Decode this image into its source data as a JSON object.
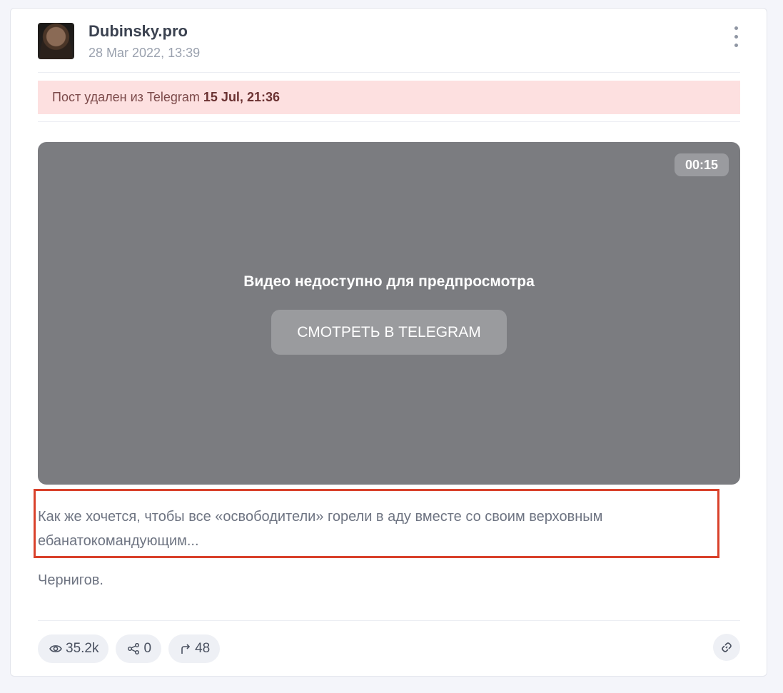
{
  "post": {
    "channel_name": "Dubinsky.pro",
    "date": "28 Mar 2022, 13:39",
    "deleted_banner": {
      "prefix": "Пост удален из Telegram ",
      "datetime": "15 Jul, 21:36"
    },
    "video": {
      "duration": "00:15",
      "unavailable_text": "Видео недоступно для предпросмотра",
      "watch_button": "СМОТРЕТЬ В TELEGRAM"
    },
    "text_paragraph_1": "Как же хочется, чтобы все «освободители» горели в аду вместе со своим верховным ебанатокомандующим...",
    "text_paragraph_2": "Чернигов.",
    "stats": {
      "views": "35.2k",
      "shares": "0",
      "forwards": "48"
    }
  },
  "colors": {
    "banner_bg": "#fde0e0",
    "video_bg": "#7b7c80",
    "highlight": "#d9412b"
  },
  "icons": {
    "menu": "vertical-dots-icon",
    "views": "eye-icon",
    "shares": "share-icon",
    "forwards": "forward-arrow-icon",
    "link": "link-icon"
  }
}
